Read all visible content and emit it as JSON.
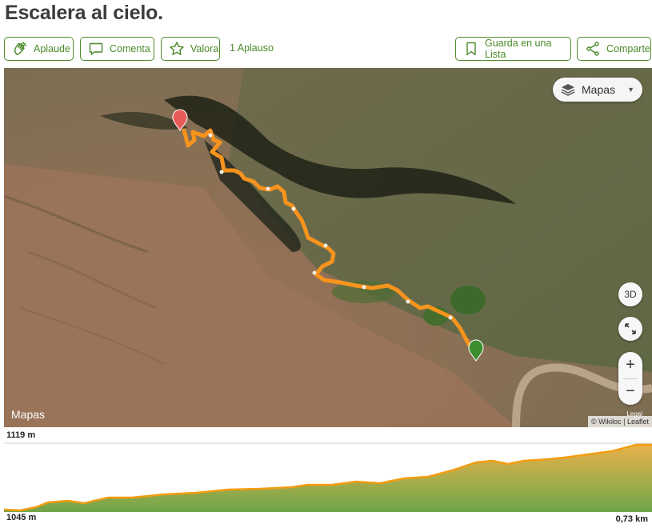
{
  "page": {
    "title": "Escalera al cielo."
  },
  "toolbar": {
    "applaud": {
      "label": "Aplaude",
      "icon": "clap-icon"
    },
    "comment": {
      "label": "Comenta",
      "icon": "comment-icon"
    },
    "rate": {
      "label": "Valora",
      "icon": "star-icon"
    },
    "applause_count": "1 Aplauso",
    "save": {
      "label": "Guarda en una Lista",
      "icon": "bookmark-icon"
    },
    "share": {
      "label": "Comparte",
      "icon": "share-icon"
    }
  },
  "map": {
    "layer_button": {
      "label": "Mapas",
      "icon": "layers-icon"
    },
    "btn_3d": "3D",
    "zoom_in": "+",
    "zoom_out": "−",
    "legal": "Legal",
    "attribution": "© Wikiloc | Leaflet",
    "provider_logo": "Mapas",
    "colors": {
      "track": "#f7941d",
      "start_marker": "#3f8e2e",
      "end_marker": "#e85a57"
    }
  },
  "elevation": {
    "max_label": "1119 m",
    "min_label": "1045 m",
    "distance_label": "0,73 km",
    "colors": {
      "line": "#f39c12",
      "fill_top": "#e8b24a",
      "fill_bottom": "#6fa64a"
    }
  }
}
